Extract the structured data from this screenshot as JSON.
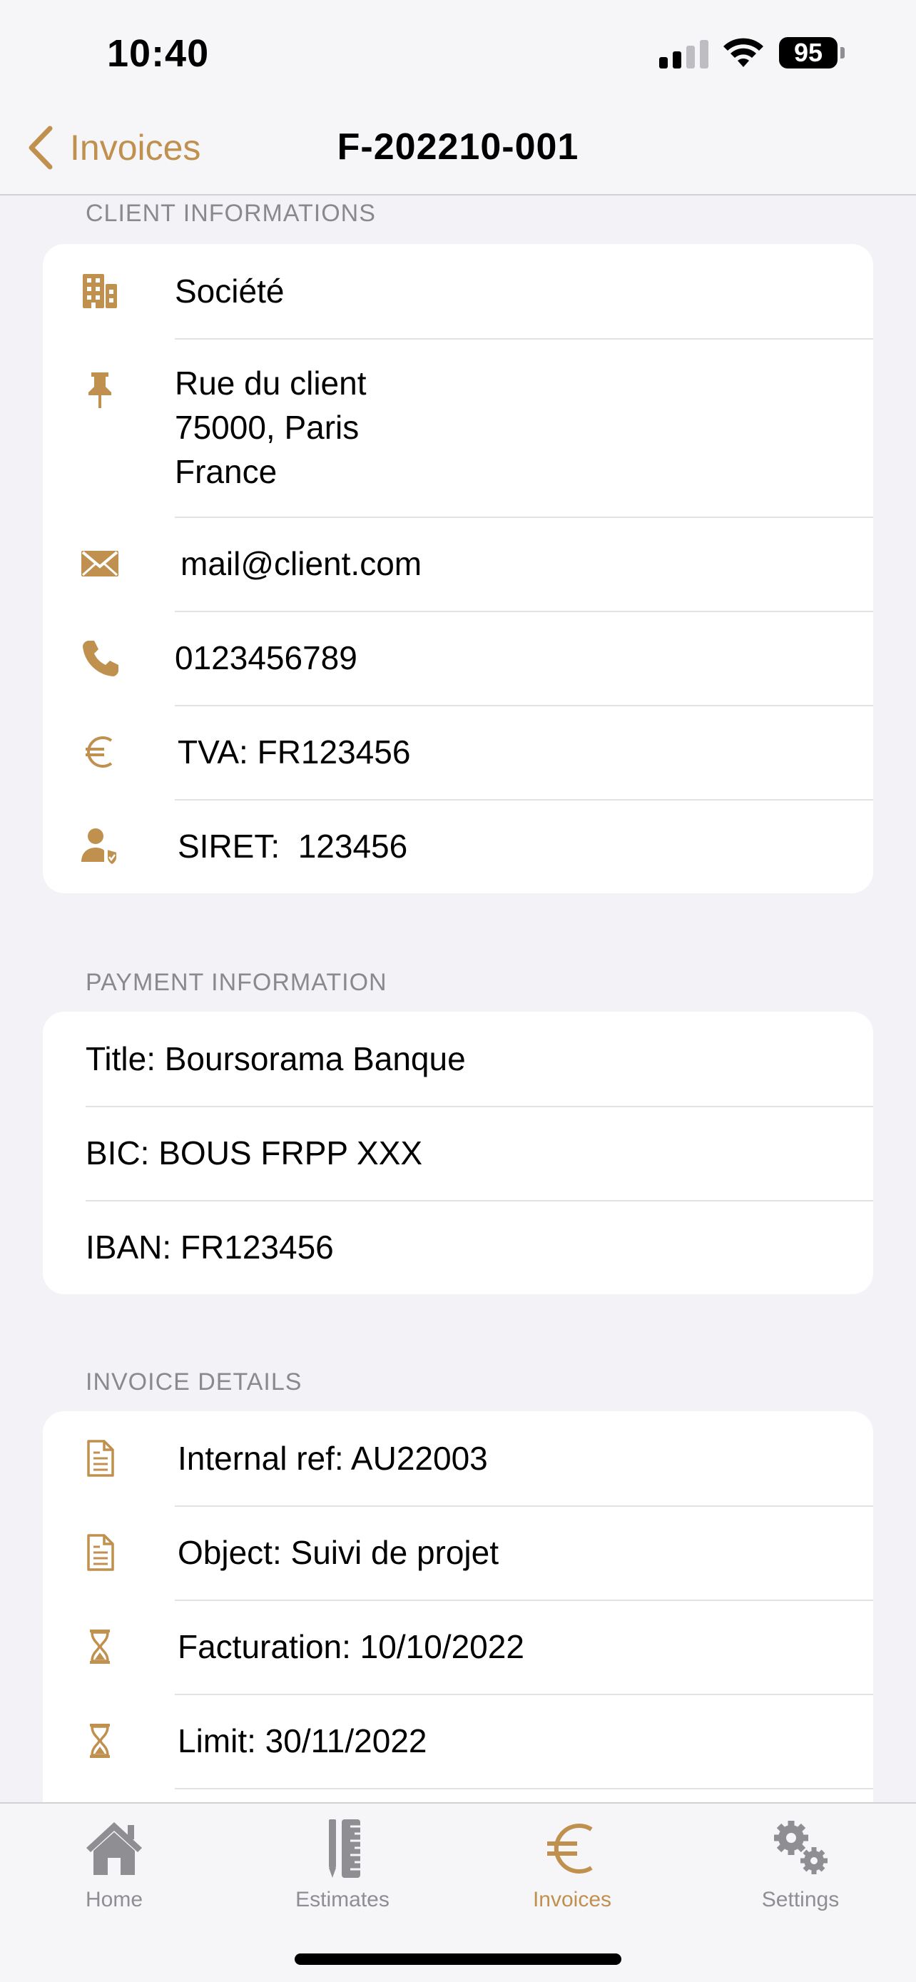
{
  "status_bar": {
    "time": "10:40",
    "battery": "95"
  },
  "nav": {
    "back_label": "Invoices",
    "title": "F-202210-001"
  },
  "client": {
    "header": "CLIENT INFORMATIONS",
    "company": "Société",
    "address_line1": "Rue du client",
    "address_line2": "75000, Paris",
    "address_line3": "France",
    "email": "mail@client.com",
    "phone": "0123456789",
    "tva": "TVA: FR123456",
    "siret": "SIRET:  123456"
  },
  "payment": {
    "header": "PAYMENT INFORMATION",
    "title": "Title: Boursorama Banque",
    "bic": "BIC: BOUS FRPP XXX",
    "iban": "IBAN: FR123456"
  },
  "details": {
    "header": "INVOICE DETAILS",
    "internal_ref": "Internal ref: AU22003",
    "object": "Object: Suivi de projet",
    "facturation": "Facturation: 10/10/2022",
    "limit": "Limit: 30/11/2022"
  },
  "tabs": [
    {
      "label": "Home",
      "icon": "house-icon"
    },
    {
      "label": "Estimates",
      "icon": "ruler-pencil-icon"
    },
    {
      "label": "Invoices",
      "icon": "euro-icon"
    },
    {
      "label": "Settings",
      "icon": "gears-icon"
    }
  ],
  "colors": {
    "accent": "#C0904F",
    "inactive": "#8E8E93",
    "background": "#F2F2F7"
  }
}
